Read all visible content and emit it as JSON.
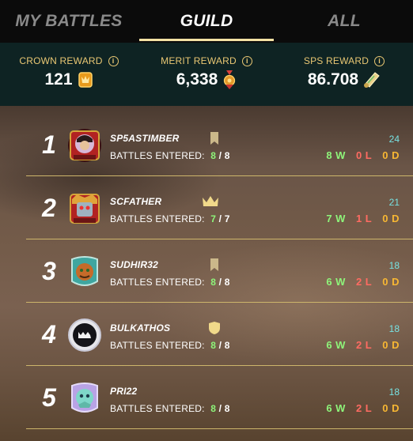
{
  "tabs": [
    {
      "label": "MY BATTLES",
      "active": false
    },
    {
      "label": "GUILD",
      "active": true
    },
    {
      "label": "ALL",
      "active": false
    }
  ],
  "rewards": [
    {
      "title": "CROWN REWARD",
      "value": "121",
      "icon": "crown-token-icon"
    },
    {
      "title": "MERIT REWARD",
      "value": "6,338",
      "icon": "merit-medal-icon"
    },
    {
      "title": "SPS REWARD",
      "value": "86.708",
      "icon": "sps-scroll-icon"
    }
  ],
  "info_label": "i",
  "battles_entered_label": "BATTLES ENTERED:",
  "players": [
    {
      "rank": "1",
      "name": "SP5ASTIMBER",
      "entered": "8",
      "total": "8",
      "points": "24",
      "wins": "8 W",
      "losses": "0 L",
      "draws": "0 D",
      "badge": "bookmark-icon",
      "avatar": "avatar-samurai"
    },
    {
      "rank": "2",
      "name": "SCFATHER",
      "entered": "7",
      "total": "7",
      "points": "21",
      "wins": "7 W",
      "losses": "1 L",
      "draws": "0 D",
      "badge": "crown-icon",
      "avatar": "avatar-robot"
    },
    {
      "rank": "3",
      "name": "SUDHIR32",
      "entered": "8",
      "total": "8",
      "points": "18",
      "wins": "6 W",
      "losses": "2 L",
      "draws": "0 D",
      "badge": "bookmark-icon",
      "avatar": "avatar-goblin"
    },
    {
      "rank": "4",
      "name": "BULKATHOS",
      "entered": "8",
      "total": "8",
      "points": "18",
      "wins": "6 W",
      "losses": "2 L",
      "draws": "0 D",
      "badge": "shield-icon",
      "avatar": "avatar-monster"
    },
    {
      "rank": "5",
      "name": "PRI22",
      "entered": "8",
      "total": "8",
      "points": "18",
      "wins": "6 W",
      "losses": "2 L",
      "draws": "0 D",
      "badge": "",
      "avatar": "avatar-creature"
    }
  ],
  "colors": {
    "accent": "#f3e2a4",
    "gold": "#e9c773",
    "win": "#8ef57a",
    "loss": "#ff6b62",
    "draw": "#f7b733",
    "points": "#77e2e2",
    "header_bg": "#0e2323"
  }
}
